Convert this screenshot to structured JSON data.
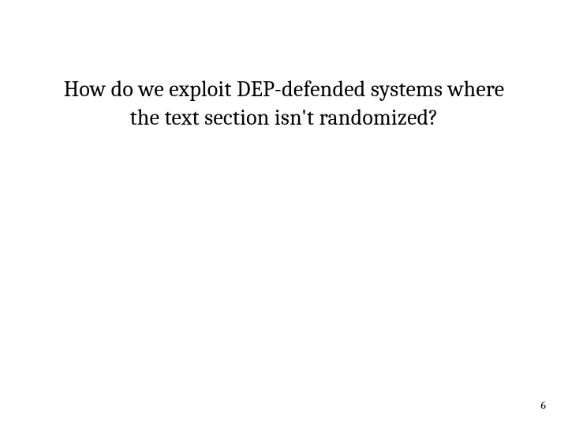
{
  "slide": {
    "title": "How do we exploit DEP-defended systems where the text section isn't randomized?",
    "page_number": "6"
  }
}
